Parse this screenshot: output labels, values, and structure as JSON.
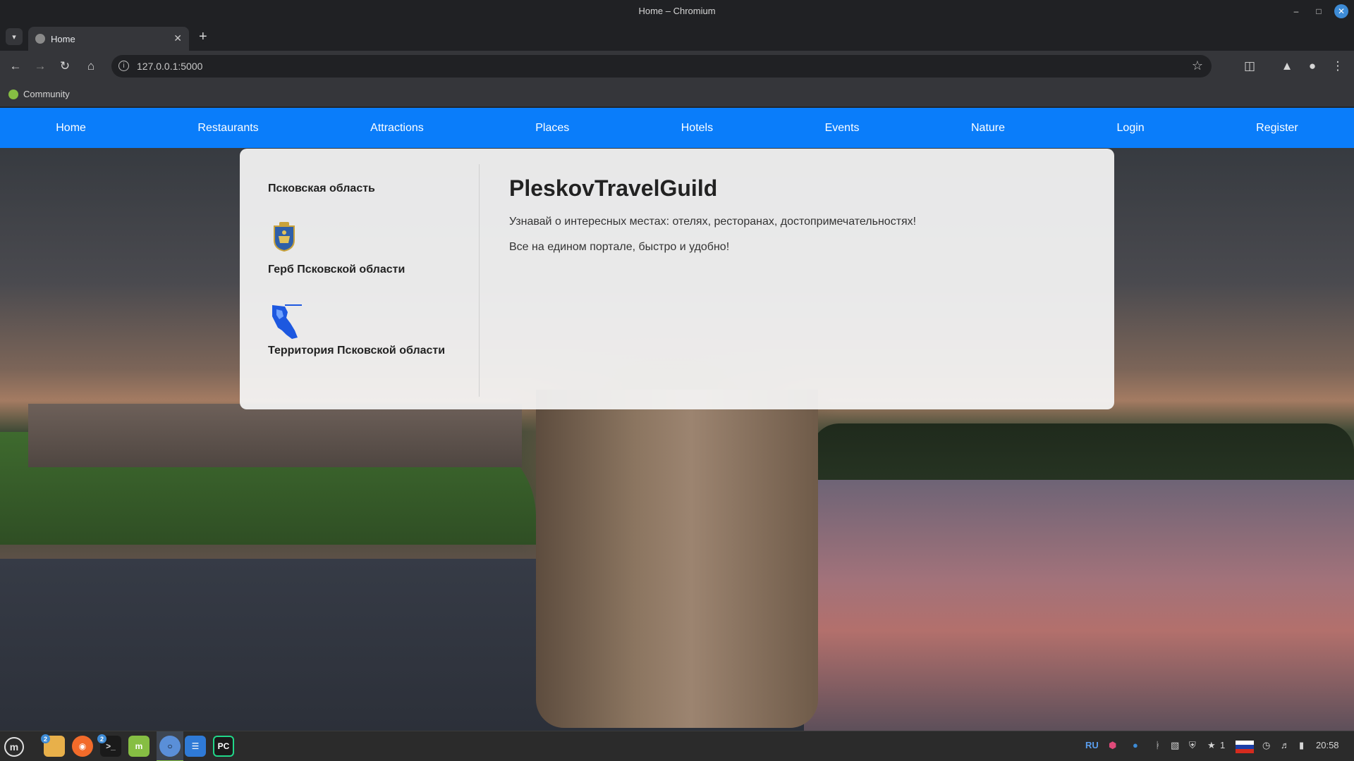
{
  "window": {
    "title": "Home – Chromium"
  },
  "tabs": [
    {
      "label": "Home"
    }
  ],
  "address_bar": {
    "url": "127.0.0.1:5000"
  },
  "bookmarks": [
    {
      "label": "Community"
    }
  ],
  "site_nav": {
    "items": [
      "Home",
      "Restaurants",
      "Attractions",
      "Places",
      "Hotels",
      "Events",
      "Nature",
      "Login",
      "Register"
    ]
  },
  "sidebar": {
    "region_title": "Псковская область",
    "crest_caption": "Герб Псковской области",
    "territory_caption": "Территория Псковской области"
  },
  "main": {
    "heading": "PleskovTravelGuild",
    "paragraph1": "Узнавай о интересных местах: отелях, ресторанах, достопримечательностях!",
    "paragraph2": "Все на едином портале, быстро и удобно!"
  },
  "taskbar": {
    "apps": [
      {
        "icon": "files-icon",
        "badge": "2"
      },
      {
        "icon": "firefox-icon"
      },
      {
        "icon": "terminal-icon",
        "badge": "2"
      },
      {
        "icon": "mint-software-icon"
      },
      {
        "icon": "chromium-icon"
      },
      {
        "icon": "text-editor-icon"
      },
      {
        "icon": "pycharm-icon"
      }
    ],
    "keyboard_layout": "RU",
    "notification_count": "1",
    "clock": "20:58"
  }
}
